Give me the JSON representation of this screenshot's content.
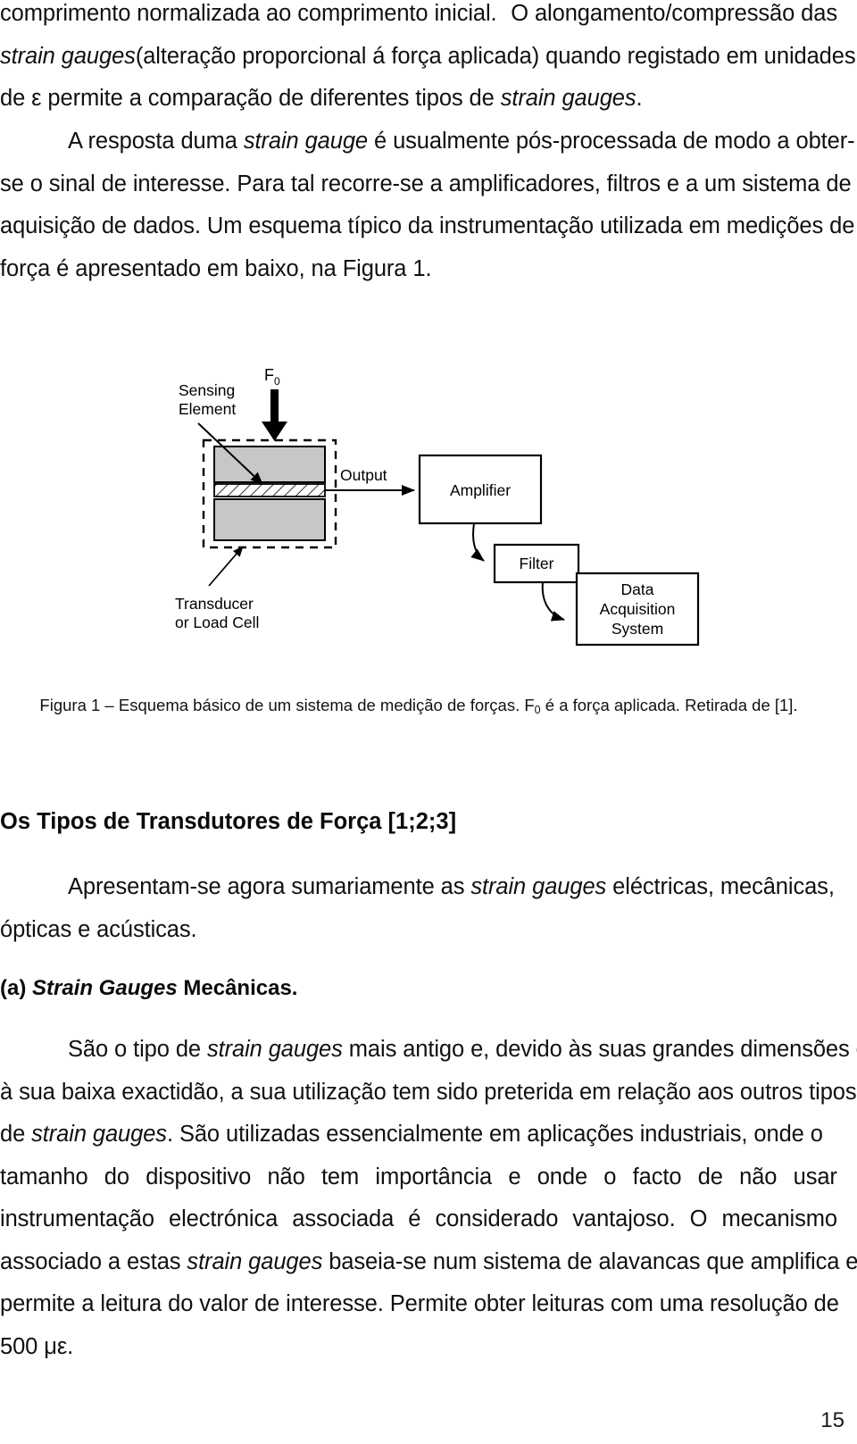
{
  "document": {
    "page_number": "15",
    "paragraph_1": {
      "lines": [
        "comprimento normalizada ao comprimento inicial. O alongamento/compressão das",
        "strain gauges (alteração proporcional á força aplicada) quando registado em unidades",
        "de ε permite a comparação de diferentes tipos de strain gauges."
      ],
      "l1_a": "comprimento normalizada ao comprimento inicial.",
      "l1_b": "O alongamento/compressão das",
      "l2_italic": "strain gauges",
      "l2_rest": "(alteração proporcional á força aplicada) quando registado em unidades",
      "l3_a": "de ε permite a comparação de diferentes tipos de ",
      "l3_italic": "strain gauges",
      "l3_b": "."
    },
    "paragraph_2": {
      "l1_a": "A resposta duma ",
      "l1_italic": "strain gauge",
      "l1_b": " é usualmente pós-processada de modo a obter-",
      "l2": "se o sinal de interesse. Para tal recorre-se a amplificadores, filtros e a um sistema de",
      "l3": "aquisição de dados. Um esquema típico da instrumentação utilizada em medições de",
      "l4": "força é apresentado em baixo, na Figura 1."
    },
    "figure": {
      "force_label": "F",
      "force_sub": "0",
      "sensing_element_label_line1": "Sensing",
      "sensing_element_label_line2": "Element",
      "transducer_label_line1": "Transducer",
      "transducer_label_line2": "or Load Cell",
      "output_label": "Output",
      "amplifier_label": "Amplifier",
      "filter_label": "Filter",
      "daq_label_line1": "Data",
      "daq_label_line2": "Acquisition",
      "daq_label_line3": "System",
      "block_fill": "#c7c7c7",
      "stroke": "#000000"
    },
    "caption": {
      "prefix": "Figura 1 – Esquema básico de um sistema de medição de forças. F",
      "sub": "0",
      "suffix": " é a força aplicada. Retirada de [1]."
    },
    "section_heading": "Os Tipos de Transdutores de Força [1;2;3]",
    "paragraph_3": {
      "l1_a": "Apresentam-se agora sumariamente as ",
      "l1_italic": "strain gauges",
      "l1_b": " eléctricas, mecânicas,",
      "l2": "ópticas e acústicas."
    },
    "subsection_heading": {
      "prefix": "(a) ",
      "italic": "Strain Gauges",
      "suffix": " Mecânicas."
    },
    "paragraph_4": {
      "l1_a": "São o tipo de ",
      "l1_italic": "strain gauges",
      "l1_b": " mais antigo e, devido às suas grandes dimensões e",
      "l2": "à sua baixa exactidão, a sua utilização tem sido preterida em relação aos outros tipos",
      "l3_a": "de ",
      "l3_italic": "strain gauges",
      "l3_b": ". São utilizadas essencialmente em aplicações industriais, onde o",
      "l4": "tamanho do dispositivo não tem importância e onde o facto de não usar",
      "l5": "instrumentação electrónica associada é considerado vantajoso. O mecanismo",
      "l6_a": "associado a estas ",
      "l6_italic": "strain gauges",
      "l6_b": " baseia-se num sistema de alavancas que amplifica e",
      "l7": "permite a leitura do valor de interesse. Permite obter leituras com uma resolução de",
      "l8": "500 με."
    }
  }
}
